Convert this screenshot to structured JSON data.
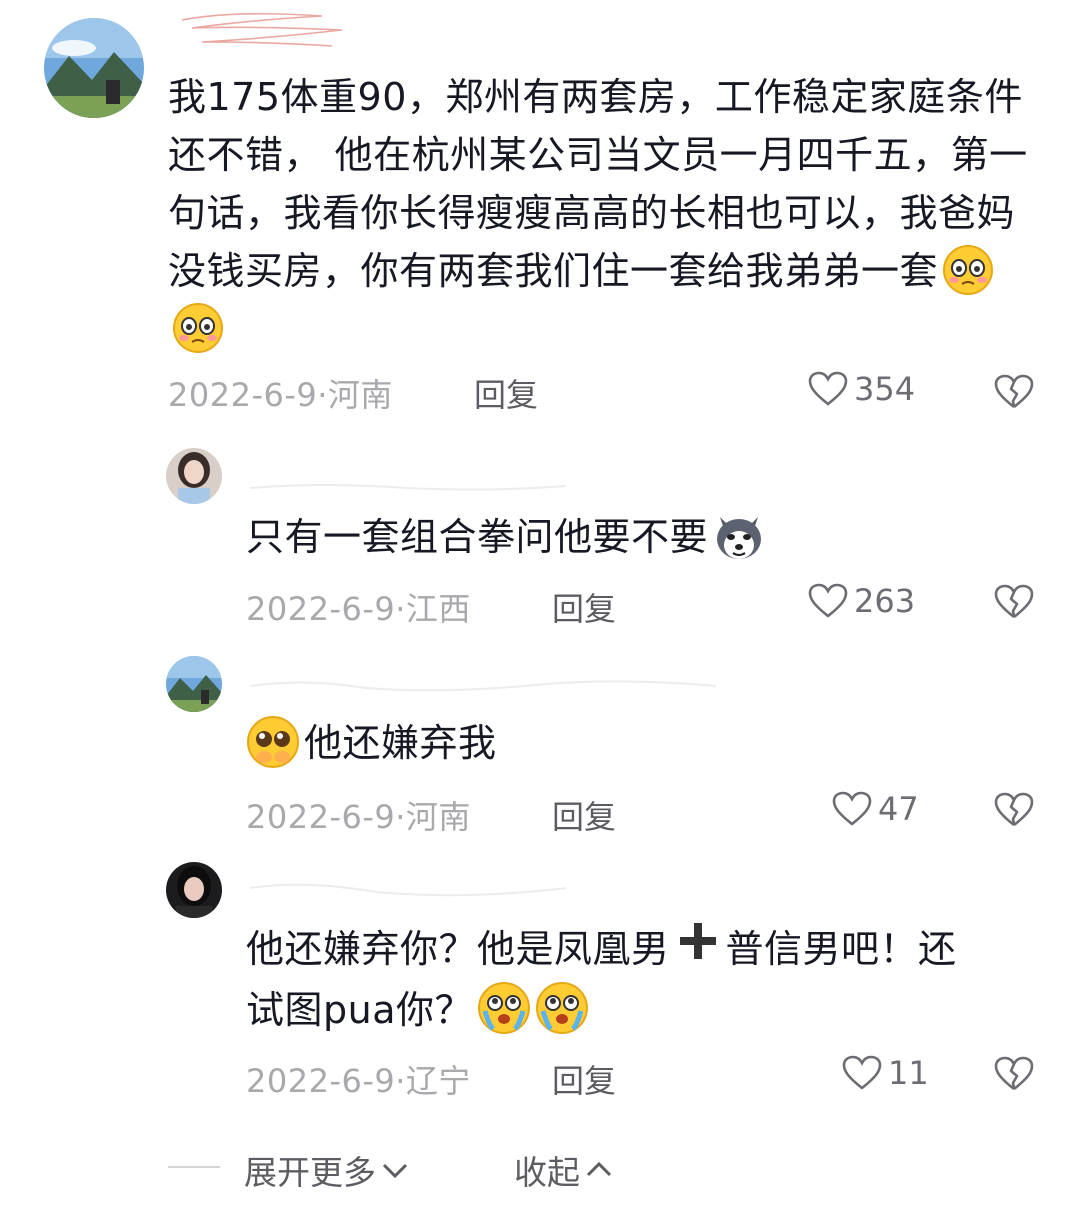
{
  "main_comment": {
    "text": "我175体重90，郑州有两套房，工作稳定家庭条件还不错， 他在杭州某公司当文员一月四千五，第一句话，我看你长得瘦瘦高高的长相也可以，我爸妈没钱买房，你有两套我们住一套给我弟弟一套",
    "emojis": [
      "flushed-face-icon",
      "flushed-face-icon"
    ],
    "date": "2022-6-9",
    "location": "河南",
    "reply_label": "回复",
    "likes": "354"
  },
  "replies": [
    {
      "text": "只有一套组合拳问他要不要",
      "emoji": "husky-dog-icon",
      "date": "2022-6-9",
      "location": "江西",
      "reply_label": "回复",
      "likes": "263"
    },
    {
      "text": "他还嫌弃我",
      "emoji": "pleading-face-icon",
      "date": "2022-6-9",
      "location": "河南",
      "reply_label": "回复",
      "likes": "47"
    },
    {
      "text_line1": "他还嫌弃你？他是凤凰男",
      "text_line1b": "普信男吧！还",
      "text_line2": "试图pua你？",
      "emojis": [
        "crying-face-icon",
        "crying-face-icon"
      ],
      "date": "2022-6-9",
      "location": "辽宁",
      "reply_label": "回复",
      "likes": "11"
    }
  ],
  "footer": {
    "expand_label": "展开更多",
    "collapse_label": "收起"
  },
  "colors": {
    "text": "#161823",
    "meta": "#a8a9ad",
    "icon": "#6c6d72"
  }
}
